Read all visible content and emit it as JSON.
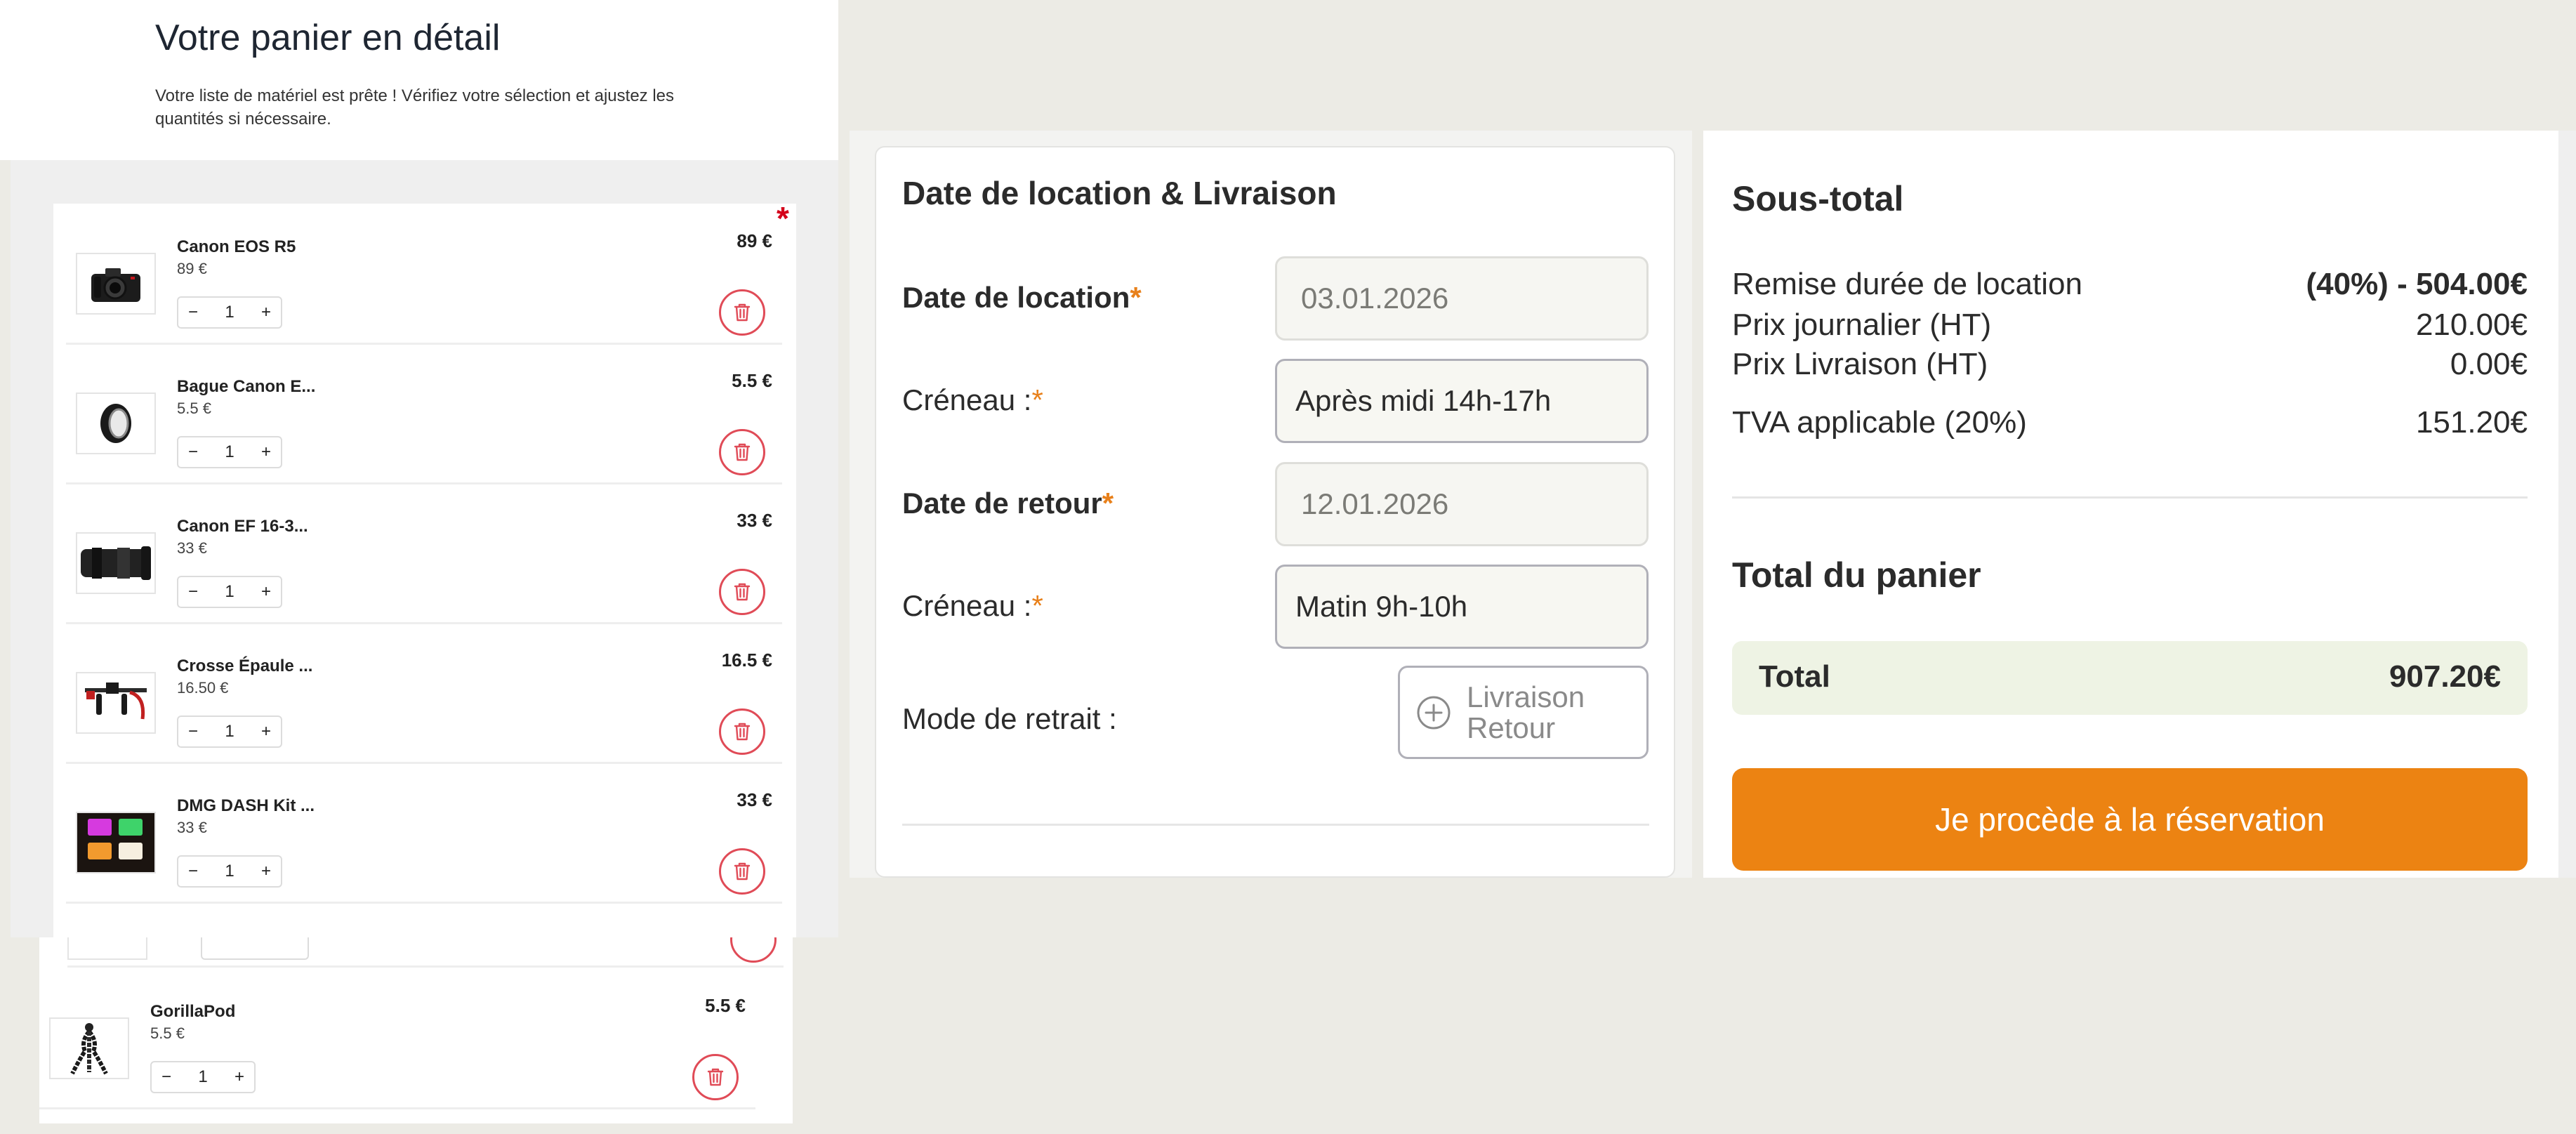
{
  "cart": {
    "title": "Votre panier en détail",
    "subtitle": "Votre liste de matériel est prête ! Vérifiez votre sélection et ajustez les quantités si nécessaire.",
    "required_mark": "*",
    "items": [
      {
        "name": "Canon EOS R5",
        "unit_price": "89 €",
        "total": "89 €",
        "quantity": "1",
        "thumb": "camera-body"
      },
      {
        "name": "Bague Canon E...",
        "unit_price": "5.5 €",
        "total": "5.5 €",
        "quantity": "1",
        "thumb": "lens-adapter-ring"
      },
      {
        "name": "Canon EF 16-3...",
        "unit_price": "33 €",
        "total": "33 €",
        "quantity": "1",
        "thumb": "zoom-lens"
      },
      {
        "name": "Crosse Épaule ...",
        "unit_price": "16.50 €",
        "total": "16.5 €",
        "quantity": "1",
        "thumb": "shoulder-rig"
      },
      {
        "name": "DMG DASH Kit ...",
        "unit_price": "33 €",
        "total": "33 €",
        "quantity": "1",
        "thumb": "led-panels"
      },
      {
        "name": "GorillaPod",
        "unit_price": "5.5 €",
        "total": "5.5 €",
        "quantity": "1",
        "thumb": "flexible-tripod"
      }
    ],
    "minus": "−",
    "plus": "+"
  },
  "rental": {
    "title": "Date de location & Livraison",
    "required_mark": "*",
    "start_label": "Date de location",
    "start_value": "03.01.2026",
    "start_slot_label": "Créneau :",
    "start_slot_value": "Après midi 14h-17h",
    "end_label": "Date de retour",
    "end_value": "12.01.2026",
    "end_slot_label": "Créneau :",
    "end_slot_value": "Matin 9h-10h",
    "mode_label": "Mode de retrait :",
    "mode_line1": "Livraison",
    "mode_line2": "Retour"
  },
  "summary": {
    "title": "Sous-total",
    "discount_label": "Remise durée de location",
    "discount_value": "(40%) - 504.00€",
    "daily_label": "Prix journalier (HT)",
    "daily_value": "210.00€",
    "delivery_label": "Prix Livraison (HT)",
    "delivery_value": "0.00€",
    "vat_label": "TVA applicable (20%)",
    "vat_value": "151.20€",
    "total_title": "Total du panier",
    "total_label": "Total",
    "total_value": "907.20€",
    "cta": "Je procède à la réservation"
  },
  "colors": {
    "accent": "#ec8312",
    "required": "#e8801a",
    "danger": "#e04b57",
    "total_bg": "#eef3e4"
  }
}
